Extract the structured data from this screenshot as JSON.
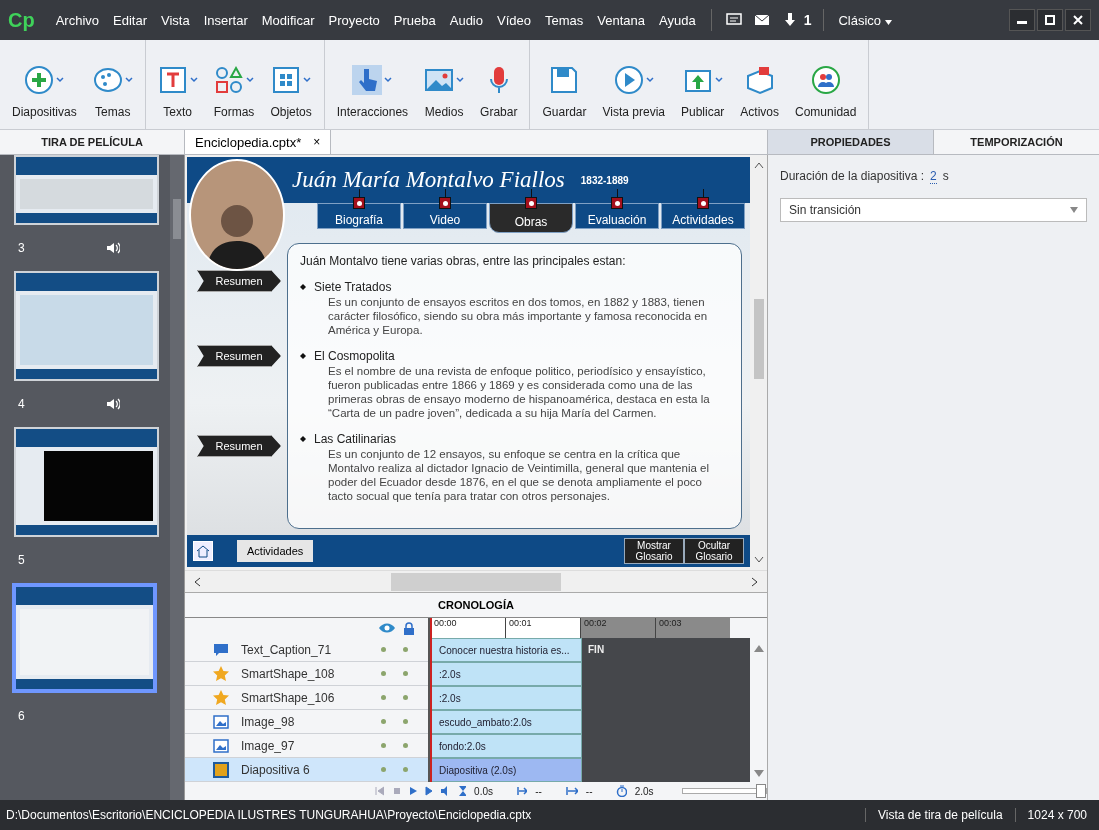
{
  "app": {
    "logo": "Cp",
    "menu": [
      "Archivo",
      "Editar",
      "Vista",
      "Insertar",
      "Modificar",
      "Proyecto",
      "Prueba",
      "Audio",
      "Vídeo",
      "Temas",
      "Ventana",
      "Ayuda"
    ],
    "download_count": "1",
    "workspace": "Clásico"
  },
  "toolbar": [
    {
      "label": "Diapositivas",
      "dropdown": true
    },
    {
      "label": "Temas",
      "dropdown": true
    },
    {
      "label": "Texto",
      "dropdown": true
    },
    {
      "label": "Formas",
      "dropdown": true
    },
    {
      "label": "Objetos",
      "dropdown": true
    },
    {
      "label": "Interacciones",
      "dropdown": true
    },
    {
      "label": "Medios",
      "dropdown": true
    },
    {
      "label": "Grabar",
      "dropdown": false
    },
    {
      "label": "Guardar",
      "dropdown": false
    },
    {
      "label": "Vista previa",
      "dropdown": true
    },
    {
      "label": "Publicar",
      "dropdown": true
    },
    {
      "label": "Activos",
      "dropdown": false
    },
    {
      "label": "Comunidad",
      "dropdown": false
    }
  ],
  "filmstrip": {
    "title": "TIRA DE PELÍCULA",
    "slides": [
      {
        "number": "3",
        "audio": true,
        "selected": false,
        "kind": "menu"
      },
      {
        "number": "4",
        "audio": true,
        "selected": false,
        "kind": "table"
      },
      {
        "number": "5",
        "audio": false,
        "selected": false,
        "kind": "video"
      },
      {
        "number": "6",
        "audio": false,
        "selected": true,
        "kind": "text"
      }
    ]
  },
  "document_tab": {
    "label": "Enciclopedia.cptx*",
    "close": "×"
  },
  "slide": {
    "title": "Juán María Montalvo Fiallos",
    "years": "1832-1889",
    "tabs": [
      {
        "label": "Biografía",
        "selected": false
      },
      {
        "label": "Video",
        "selected": false
      },
      {
        "label": "Obras",
        "selected": true
      },
      {
        "label": "Evaluación",
        "selected": false
      },
      {
        "label": "Actividades",
        "selected": false
      }
    ],
    "intro": "Juán Montalvo tiene varias obras, entre las principales estan:",
    "sections": [
      {
        "button": "Resumen",
        "heading": "Siete Tratados",
        "body": "Es un conjunto de ensayos escritos en dos tomos, en 1882 y 1883, tienen carácter filosófico, siendo su obra más importante y famosa reconocida en América y Europa."
      },
      {
        "button": "Resumen",
        "heading": "El Cosmopolita",
        "body": "Es el nombre de una revista de enfoque politico, periodísico y ensayístico, fueron publicadas entre 1866 y 1869 y es considerada como una de las primeras obras de ensayo moderno de hispanoamérica, destaca en esta la “Carta de un padre joven”, dedicada a su hija María del Carmen."
      },
      {
        "button": "Resumen",
        "heading": "Las Catilinarias",
        "body": "Es un conjunto de 12 ensayos, su enfoque se centra en la crítica que Montalvo realiza al dictador Ignacio de Veintimilla, general que mantenia el poder del Ecuador desde 1876, en el que se denota ampliamente el poco tacto socual que tenía para tratar con otros personajes."
      }
    ],
    "activities_button": "Actividades",
    "glossary_buttons": [
      "Mostrar Glosario",
      "Ocultar Glosario"
    ]
  },
  "timeline": {
    "title": "CRONOLOGÍA",
    "ticks": [
      "00:00",
      "00:01",
      "00:02",
      "00:03"
    ],
    "end_label": "FIN",
    "rows": [
      {
        "name": "Text_Caption_71",
        "kind": "caption",
        "bar": "Conocer nuestra historia es...",
        "selected": false
      },
      {
        "name": "SmartShape_108",
        "kind": "shape",
        "bar": ":2.0s",
        "selected": false
      },
      {
        "name": "SmartShape_106",
        "kind": "shape",
        "bar": ":2.0s",
        "selected": false
      },
      {
        "name": "Image_98",
        "kind": "image",
        "bar": "escudo_ambato:2.0s",
        "selected": false
      },
      {
        "name": "Image_97",
        "kind": "image",
        "bar": "fondo:2.0s",
        "selected": false
      },
      {
        "name": "Diapositiva 6",
        "kind": "slide",
        "bar": "Diapositiva (2.0s)",
        "selected": true
      }
    ],
    "start": "0.0s",
    "fade_in": "--",
    "fade_out": "--",
    "duration": "2.0s",
    "zoom": {
      "level": 1
    }
  },
  "properties": {
    "tabs": [
      {
        "label": "PROPIEDADES",
        "selected": true
      },
      {
        "label": "TEMPORIZACIÓN",
        "selected": false
      }
    ],
    "duration_label": "Duración de la diapositiva :",
    "duration_value": "2",
    "duration_unit": "s",
    "transition": "Sin transición"
  },
  "status_bar": {
    "path": "D:\\Documentos\\Escritorio\\ENCICLOPEDIA ILUSTRES TUNGURAHUA\\Proyecto\\Enciclopedia.cptx",
    "view": "Vista de tira de película",
    "size": "1024 x 700"
  }
}
